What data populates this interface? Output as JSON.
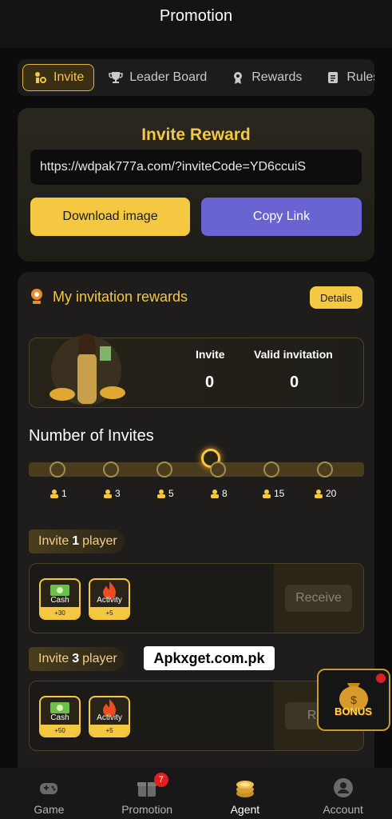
{
  "header": {
    "title": "Promotion"
  },
  "tabs": [
    {
      "label": "Invite",
      "active": true,
      "icon": "invite-icon"
    },
    {
      "label": "Leader Board",
      "icon": "trophy-icon"
    },
    {
      "label": "Rewards",
      "icon": "medal-icon"
    },
    {
      "label": "Rules",
      "icon": "document-icon"
    }
  ],
  "invite_reward": {
    "title": "Invite Reward",
    "link": "https://wdpak777a.com/?inviteCode=YD6ccuiS",
    "download_label": "Download image",
    "copy_label": "Copy Link"
  },
  "my_rewards": {
    "title": "My invitation rewards",
    "details_label": "Details",
    "invite_label": "Invite",
    "invite_value": "0",
    "valid_label": "Valid invitation",
    "valid_value": "0"
  },
  "progress": {
    "title": "Number of Invites",
    "milestones": [
      "1",
      "3",
      "5",
      "8",
      "15",
      "20"
    ],
    "highlighted_index": 3
  },
  "tasks": [
    {
      "label_prefix": "Invite",
      "count": "1",
      "label_suffix": "player",
      "items": [
        {
          "name": "Cash",
          "amount": "+30",
          "icon": "cash-icon"
        },
        {
          "name": "Activity",
          "amount": "+5",
          "icon": "fire-icon"
        }
      ],
      "button": "Receive"
    },
    {
      "label_prefix": "Invite",
      "count": "3",
      "label_suffix": "player",
      "items": [
        {
          "name": "Cash",
          "amount": "+50",
          "icon": "cash-icon"
        },
        {
          "name": "Activity",
          "amount": "+5",
          "icon": "fire-icon"
        }
      ],
      "button": "Rec"
    }
  ],
  "watermark": "Apkxget.com.pk",
  "bonus": {
    "label": "BONUS"
  },
  "nav": [
    {
      "label": "Game",
      "icon": "gamepad-icon"
    },
    {
      "label": "Promotion",
      "icon": "gift-icon",
      "badge": "7"
    },
    {
      "label": "Agent",
      "icon": "coins-icon",
      "active": true
    },
    {
      "label": "Account",
      "icon": "user-icon"
    }
  ],
  "colors": {
    "accent": "#f5c842",
    "copy_button": "#6a63d2",
    "background": "#0c0c0c"
  }
}
